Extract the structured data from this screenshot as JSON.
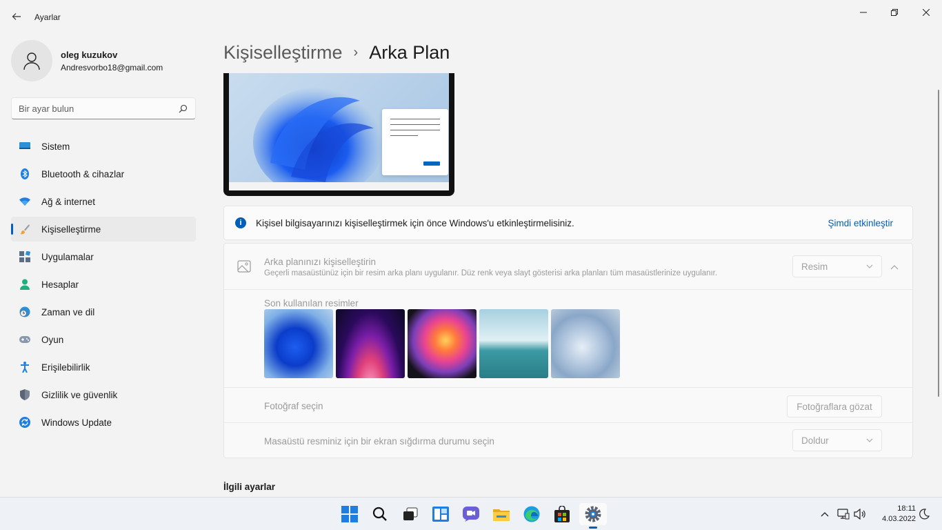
{
  "window": {
    "app_title": "Ayarlar"
  },
  "profile": {
    "name": "oleg kuzukov",
    "email": "Andresvorbo18@gmail.com"
  },
  "search": {
    "placeholder": "Bir ayar bulun"
  },
  "sidebar": {
    "items": [
      {
        "label": "Sistem",
        "icon": "system-icon"
      },
      {
        "label": "Bluetooth & cihazlar",
        "icon": "bluetooth-icon"
      },
      {
        "label": "Ağ & internet",
        "icon": "wifi-icon"
      },
      {
        "label": "Kişiselleştirme",
        "icon": "brush-icon",
        "active": true
      },
      {
        "label": "Uygulamalar",
        "icon": "apps-icon"
      },
      {
        "label": "Hesaplar",
        "icon": "account-icon"
      },
      {
        "label": "Zaman ve dil",
        "icon": "time-language-icon"
      },
      {
        "label": "Oyun",
        "icon": "gamepad-icon"
      },
      {
        "label": "Erişilebilirlik",
        "icon": "accessibility-icon"
      },
      {
        "label": "Gizlilik ve güvenlik",
        "icon": "shield-icon"
      },
      {
        "label": "Windows Update",
        "icon": "update-icon"
      }
    ]
  },
  "breadcrumb": {
    "parent": "Kişiselleştirme",
    "separator": "›",
    "current": "Arka Plan"
  },
  "activation": {
    "message": "Kişisel bilgisayarınızı kişiselleştirmek için önce Windows'u etkinleştirmelisiniz.",
    "link": "Şimdi etkinleştir"
  },
  "background": {
    "title": "Arka planınızı kişiselleştirin",
    "subtitle": "Geçerli masaüstünüz için bir resim arka planı uygulanır. Düz renk veya slayt gösterisi arka planları tüm masaüstlerinize uygulanır.",
    "type_value": "Resim",
    "recent_label": "Son kullanılan resimler",
    "recent_images": [
      "bloom-blue",
      "glow-purple",
      "ribbons-color",
      "lake-sunrise",
      "bloom-light"
    ],
    "photo_label": "Fotoğraf seçin",
    "browse_button": "Fotoğraflara gözat",
    "fit_label": "Masaüstü resminiz için bir ekran sığdırma durumu seçin",
    "fit_value": "Doldur"
  },
  "related": {
    "title": "İlgili ayarlar"
  },
  "taskbar": {
    "apps": [
      "start-icon",
      "search-icon",
      "task-view-icon",
      "widgets-icon",
      "chat-icon",
      "file-explorer-icon",
      "edge-icon",
      "store-icon",
      "settings-icon"
    ],
    "time": "18:11",
    "date": "4.03.2022"
  },
  "colors": {
    "accent": "#005fb8",
    "background": "#f3f3f3"
  }
}
